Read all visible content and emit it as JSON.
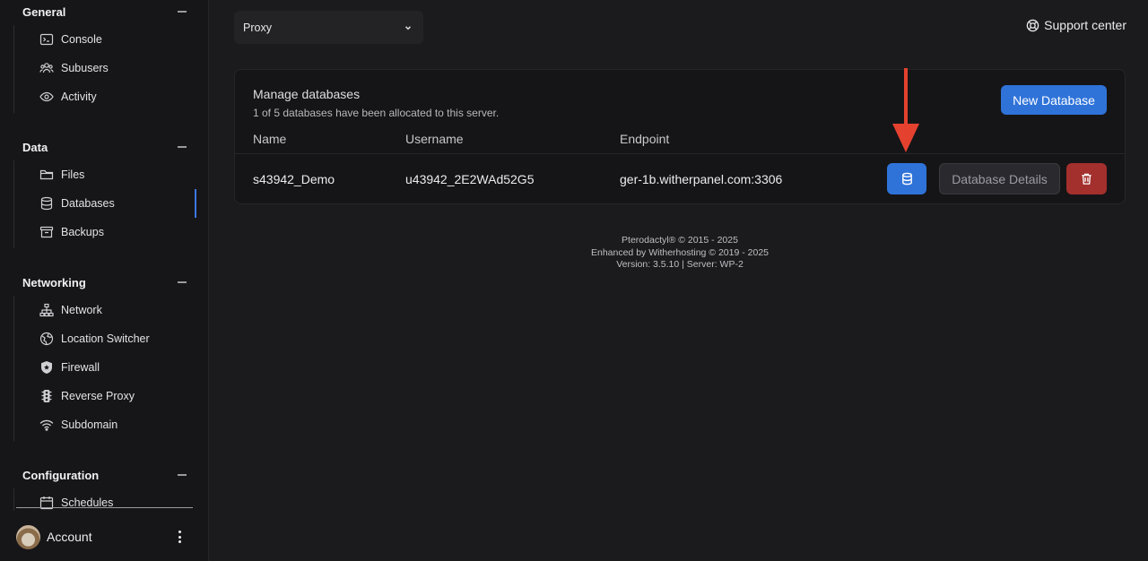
{
  "sidebar": {
    "sections": [
      {
        "title": "General",
        "items": [
          {
            "label": "Console",
            "icon": "terminal-icon"
          },
          {
            "label": "Subusers",
            "icon": "users-icon"
          },
          {
            "label": "Activity",
            "icon": "eye-icon"
          }
        ]
      },
      {
        "title": "Data",
        "items": [
          {
            "label": "Files",
            "icon": "folder-icon"
          },
          {
            "label": "Databases",
            "icon": "database-icon",
            "active": true
          },
          {
            "label": "Backups",
            "icon": "archive-icon"
          }
        ]
      },
      {
        "title": "Networking",
        "items": [
          {
            "label": "Network",
            "icon": "network-icon"
          },
          {
            "label": "Location Switcher",
            "icon": "globe-icon"
          },
          {
            "label": "Firewall",
            "icon": "shield-icon"
          },
          {
            "label": "Reverse Proxy",
            "icon": "traffic-light-icon"
          },
          {
            "label": "Subdomain",
            "icon": "wifi-icon"
          }
        ]
      },
      {
        "title": "Configuration",
        "items": [
          {
            "label": "Schedules",
            "icon": "calendar-icon"
          }
        ]
      }
    ],
    "account_label": "Account"
  },
  "header": {
    "server_selector": "Proxy",
    "support_label": "Support center"
  },
  "databases": {
    "title": "Manage databases",
    "subtitle": "1 of 5 databases have been allocated to this server.",
    "new_button": "New Database",
    "columns": [
      "Name",
      "Username",
      "Endpoint"
    ],
    "rows": [
      {
        "name": "s43942_Demo",
        "username": "u43942_2E2WAd52G5",
        "endpoint": "ger-1b.witherpanel.com:3306",
        "details_label": "Database Details"
      }
    ]
  },
  "footer": {
    "line1": "Pterodactyl® © 2015 - 2025",
    "line2": "Enhanced by Witherhosting © 2019 - 2025",
    "line3": "Version: 3.5.10 | Server: WP-2"
  },
  "colors": {
    "accent": "#2f73d9",
    "danger": "#a3302d",
    "annotation_arrow": "#e5412f"
  }
}
